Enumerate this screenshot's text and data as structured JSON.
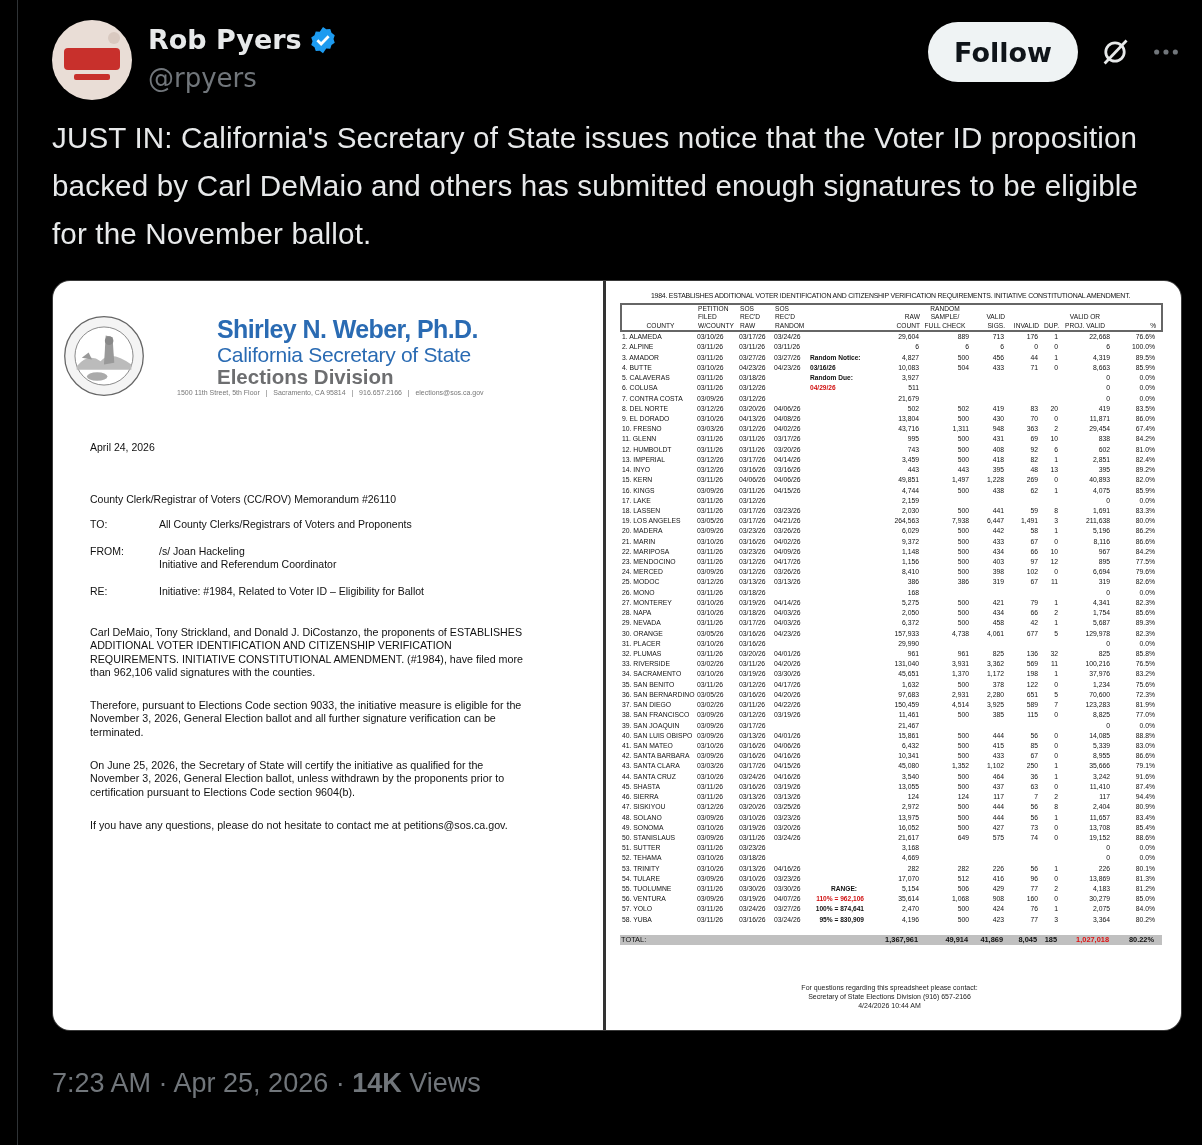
{
  "author": {
    "name": "Rob Pyers",
    "handle": "@rpyers",
    "verified": true
  },
  "follow_button": "Follow",
  "tweet_text": "JUST IN: California's Secretary of State issues notice that the Voter ID proposition backed by Carl DeMaio and others has submitted enough signatures to be eligible for the November ballot.",
  "memo": {
    "name": "Shirley N. Weber, Ph.D.",
    "office": "California Secretary of State",
    "division": "Elections Division",
    "address": "1500 11th Street, 5th Floor   |   Sacramento, CA 95814   |   916.657.2166   |   elections@sos.ca.gov",
    "date": "April 24, 2026",
    "subject": "County Clerk/Registrar of Voters (CC/ROV) Memorandum #26110",
    "fields": [
      {
        "label": "TO:",
        "lines": [
          "All County Clerks/Registrars of Voters and Proponents"
        ]
      },
      {
        "label": "FROM:",
        "lines": [
          "/s/ Joan Hackeling",
          "Initiative and Referendum Coordinator"
        ]
      },
      {
        "label": "RE:",
        "lines": [
          "Initiative: #1984, Related to Voter ID – Eligibility for Ballot"
        ]
      }
    ],
    "paragraphs": [
      "Carl DeMaio, Tony Strickland, and Donald J. DiCostanzo, the proponents of ESTABLISHES ADDITIONAL VOTER IDENTIFICATION AND CITIZENSHIP VERIFICATION REQUIREMENTS. INITIATIVE CONSTITUTIONAL AMENDMENT. (#1984), have filed more than 962,106 valid signatures with the counties.",
      "Therefore, pursuant to Elections Code section 9033, the initiative measure is eligible for the November 3, 2026, General Election ballot and all further signature verification can be terminated.",
      "On June 25, 2026, the Secretary of State will certify the initiative as qualified for the November 3, 2026, General Election ballot, unless withdrawn by the proponents prior to certification pursuant to Elections Code section 9604(b).",
      "If you have any questions, please do not hesitate to contact me at petitions@sos.ca.gov."
    ]
  },
  "sheet": {
    "title": "1984. ESTABLISHES ADDITIONAL VOTER IDENTIFICATION AND CITIZENSHIP VERIFICATION REQUIREMENTS. INITIATIVE CONSTITUTIONAL AMENDMENT.",
    "columns": [
      "COUNTY",
      "PETITION\nFILED\nW/COUNTY",
      "SOS\nREC'D\nRAW",
      "SOS\nREC'D\nRANDOM",
      "RAW\nCOUNT",
      "RANDOM\nSAMPLE/\nFULL CHECK",
      "VALID\nSIGS.",
      "INVALID",
      "DUP.",
      "VALID OR\nPROJ. VALID",
      "%"
    ],
    "rows": [
      {
        "cells": [
          "1. ALAMEDA",
          "03/10/26",
          "03/17/26",
          "03/24/26",
          "29,604",
          "889",
          "713",
          "176",
          "1",
          "22,668",
          "76.6%"
        ]
      },
      {
        "cells": [
          "2. ALPINE",
          "03/11/26",
          "03/11/26",
          "03/11/26",
          "6",
          "6",
          "6",
          "0",
          "0",
          "6",
          "100.0%"
        ]
      },
      {
        "cells": [
          "3. AMADOR",
          "03/11/26",
          "03/27/26",
          "03/27/26",
          "4,827",
          "500",
          "456",
          "44",
          "1",
          "4,319",
          "89.5%"
        ],
        "note": {
          "text": "Random Notice:",
          "kind": "notice"
        }
      },
      {
        "cells": [
          "4. BUTTE",
          "03/10/26",
          "04/23/26",
          "04/23/26",
          "10,083",
          "504",
          "433",
          "71",
          "0",
          "8,663",
          "85.9%"
        ],
        "note": {
          "text": "03/16/26",
          "kind": "notice"
        }
      },
      {
        "cells": [
          "5. CALAVERAS",
          "03/11/26",
          "03/18/26",
          null,
          "3,927",
          null,
          null,
          null,
          null,
          "0",
          "0.0%"
        ],
        "note": {
          "text": "Random Due:",
          "kind": "notice"
        }
      },
      {
        "cells": [
          "6. COLUSA",
          "03/11/26",
          "03/12/26",
          null,
          "511",
          null,
          null,
          null,
          null,
          "0",
          "0.0%"
        ],
        "note": {
          "text": "04/29/26",
          "kind": "alert"
        }
      },
      {
        "cells": [
          "7. CONTRA COSTA",
          "03/09/26",
          "03/12/26",
          null,
          "21,679",
          null,
          null,
          null,
          null,
          "0",
          "0.0%"
        ]
      },
      {
        "cells": [
          "8. DEL NORTE",
          "03/12/26",
          "03/20/26",
          "04/06/26",
          "502",
          "502",
          "419",
          "83",
          "20",
          "419",
          "83.5%"
        ]
      },
      {
        "cells": [
          "9. EL DORADO",
          "03/10/26",
          "04/13/26",
          "04/08/26",
          "13,804",
          "500",
          "430",
          "70",
          "0",
          "11,871",
          "86.0%"
        ]
      },
      {
        "cells": [
          "10. FRESNO",
          "03/03/26",
          "03/12/26",
          "04/02/26",
          "43,716",
          "1,311",
          "948",
          "363",
          "2",
          "29,454",
          "67.4%"
        ]
      },
      {
        "cells": [
          "11. GLENN",
          "03/11/26",
          "03/11/26",
          "03/17/26",
          "995",
          "500",
          "431",
          "69",
          "10",
          "838",
          "84.2%"
        ]
      },
      {
        "cells": [
          "12. HUMBOLDT",
          "03/11/26",
          "03/11/26",
          "03/20/26",
          "743",
          "500",
          "408",
          "92",
          "6",
          "602",
          "81.0%"
        ]
      },
      {
        "cells": [
          "13. IMPERIAL",
          "03/12/26",
          "03/17/26",
          "04/14/26",
          "3,459",
          "500",
          "418",
          "82",
          "1",
          "2,851",
          "82.4%"
        ]
      },
      {
        "cells": [
          "14. INYO",
          "03/12/26",
          "03/16/26",
          "03/16/26",
          "443",
          "443",
          "395",
          "48",
          "13",
          "395",
          "89.2%"
        ]
      },
      {
        "cells": [
          "15. KERN",
          "03/11/26",
          "04/06/26",
          "04/06/26",
          "49,851",
          "1,497",
          "1,228",
          "269",
          "0",
          "40,893",
          "82.0%"
        ]
      },
      {
        "cells": [
          "16. KINGS",
          "03/09/26",
          "03/11/26",
          "04/15/26",
          "4,744",
          "500",
          "438",
          "62",
          "1",
          "4,075",
          "85.9%"
        ]
      },
      {
        "cells": [
          "17. LAKE",
          "03/11/26",
          "03/12/26",
          null,
          "2,159",
          null,
          null,
          null,
          null,
          "0",
          "0.0%"
        ]
      },
      {
        "cells": [
          "18. LASSEN",
          "03/11/26",
          "03/17/26",
          "03/23/26",
          "2,030",
          "500",
          "441",
          "59",
          "8",
          "1,691",
          "83.3%"
        ]
      },
      {
        "cells": [
          "19. LOS ANGELES",
          "03/05/26",
          "03/17/26",
          "04/21/26",
          "264,563",
          "7,938",
          "6,447",
          "1,491",
          "3",
          "211,638",
          "80.0%"
        ]
      },
      {
        "cells": [
          "20. MADERA",
          "03/09/26",
          "03/23/26",
          "03/26/26",
          "6,029",
          "500",
          "442",
          "58",
          "1",
          "5,196",
          "86.2%"
        ]
      },
      {
        "cells": [
          "21. MARIN",
          "03/10/26",
          "03/16/26",
          "04/02/26",
          "9,372",
          "500",
          "433",
          "67",
          "0",
          "8,116",
          "86.6%"
        ]
      },
      {
        "cells": [
          "22. MARIPOSA",
          "03/11/26",
          "03/23/26",
          "04/09/26",
          "1,148",
          "500",
          "434",
          "66",
          "10",
          "967",
          "84.2%"
        ]
      },
      {
        "cells": [
          "23. MENDOCINO",
          "03/11/26",
          "03/12/26",
          "04/17/26",
          "1,156",
          "500",
          "403",
          "97",
          "12",
          "895",
          "77.5%"
        ]
      },
      {
        "cells": [
          "24. MERCED",
          "03/09/26",
          "03/12/26",
          "03/26/26",
          "8,410",
          "500",
          "398",
          "102",
          "0",
          "6,694",
          "79.6%"
        ]
      },
      {
        "cells": [
          "25. MODOC",
          "03/12/26",
          "03/13/26",
          "03/13/26",
          "386",
          "386",
          "319",
          "67",
          "11",
          "319",
          "82.6%"
        ]
      },
      {
        "cells": [
          "26. MONO",
          "03/11/26",
          "03/18/26",
          null,
          "168",
          null,
          null,
          null,
          null,
          "0",
          "0.0%"
        ]
      },
      {
        "cells": [
          "27. MONTEREY",
          "03/10/26",
          "03/19/26",
          "04/14/26",
          "5,275",
          "500",
          "421",
          "79",
          "1",
          "4,341",
          "82.3%"
        ]
      },
      {
        "cells": [
          "28. NAPA",
          "03/10/26",
          "03/18/26",
          "04/03/26",
          "2,050",
          "500",
          "434",
          "66",
          "2",
          "1,754",
          "85.6%"
        ]
      },
      {
        "cells": [
          "29. NEVADA",
          "03/11/26",
          "03/17/26",
          "04/03/26",
          "6,372",
          "500",
          "458",
          "42",
          "1",
          "5,687",
          "89.3%"
        ]
      },
      {
        "cells": [
          "30. ORANGE",
          "03/05/26",
          "03/16/26",
          "04/23/26",
          "157,933",
          "4,738",
          "4,061",
          "677",
          "5",
          "129,978",
          "82.3%"
        ]
      },
      {
        "cells": [
          "31. PLACER",
          "03/10/26",
          "03/16/26",
          null,
          "29,990",
          null,
          null,
          null,
          null,
          "0",
          "0.0%"
        ]
      },
      {
        "cells": [
          "32. PLUMAS",
          "03/11/26",
          "03/20/26",
          "04/01/26",
          "961",
          "961",
          "825",
          "136",
          "32",
          "825",
          "85.8%"
        ]
      },
      {
        "cells": [
          "33. RIVERSIDE",
          "03/02/26",
          "03/11/26",
          "04/20/26",
          "131,040",
          "3,931",
          "3,362",
          "569",
          "11",
          "100,216",
          "76.5%"
        ]
      },
      {
        "cells": [
          "34. SACRAMENTO",
          "03/10/26",
          "03/19/26",
          "03/30/26",
          "45,651",
          "1,370",
          "1,172",
          "198",
          "1",
          "37,976",
          "83.2%"
        ]
      },
      {
        "cells": [
          "35. SAN BENITO",
          "03/11/26",
          "03/12/26",
          "04/17/26",
          "1,632",
          "500",
          "378",
          "122",
          "0",
          "1,234",
          "75.6%"
        ]
      },
      {
        "cells": [
          "36. SAN BERNARDINO",
          "03/05/26",
          "03/16/26",
          "04/20/26",
          "97,683",
          "2,931",
          "2,280",
          "651",
          "5",
          "70,600",
          "72.3%"
        ]
      },
      {
        "cells": [
          "37. SAN DIEGO",
          "03/02/26",
          "03/11/26",
          "04/22/26",
          "150,459",
          "4,514",
          "3,925",
          "589",
          "7",
          "123,283",
          "81.9%"
        ]
      },
      {
        "cells": [
          "38. SAN FRANCISCO",
          "03/09/26",
          "03/12/26",
          "03/19/26",
          "11,461",
          "500",
          "385",
          "115",
          "0",
          "8,825",
          "77.0%"
        ]
      },
      {
        "cells": [
          "39. SAN JOAQUIN",
          "03/09/26",
          "03/17/26",
          null,
          "21,467",
          null,
          null,
          null,
          null,
          "0",
          "0.0%"
        ]
      },
      {
        "cells": [
          "40. SAN LUIS OBISPO",
          "03/09/26",
          "03/13/26",
          "04/01/26",
          "15,861",
          "500",
          "444",
          "56",
          "0",
          "14,085",
          "88.8%"
        ]
      },
      {
        "cells": [
          "41. SAN MATEO",
          "03/10/26",
          "03/16/26",
          "04/06/26",
          "6,432",
          "500",
          "415",
          "85",
          "0",
          "5,339",
          "83.0%"
        ]
      },
      {
        "cells": [
          "42. SANTA BARBARA",
          "03/09/26",
          "03/16/26",
          "04/16/26",
          "10,341",
          "500",
          "433",
          "67",
          "0",
          "8,955",
          "86.6%"
        ]
      },
      {
        "cells": [
          "43. SANTA CLARA",
          "03/03/26",
          "03/17/26",
          "04/15/26",
          "45,080",
          "1,352",
          "1,102",
          "250",
          "1",
          "35,666",
          "79.1%"
        ]
      },
      {
        "cells": [
          "44. SANTA CRUZ",
          "03/10/26",
          "03/24/26",
          "04/16/26",
          "3,540",
          "500",
          "464",
          "36",
          "1",
          "3,242",
          "91.6%"
        ]
      },
      {
        "cells": [
          "45. SHASTA",
          "03/11/26",
          "03/16/26",
          "03/19/26",
          "13,055",
          "500",
          "437",
          "63",
          "0",
          "11,410",
          "87.4%"
        ]
      },
      {
        "cells": [
          "46. SIERRA",
          "03/11/26",
          "03/13/26",
          "03/13/26",
          "124",
          "124",
          "117",
          "7",
          "2",
          "117",
          "94.4%"
        ]
      },
      {
        "cells": [
          "47. SISKIYOU",
          "03/12/26",
          "03/20/26",
          "03/25/26",
          "2,972",
          "500",
          "444",
          "56",
          "8",
          "2,404",
          "80.9%"
        ]
      },
      {
        "cells": [
          "48. SOLANO",
          "03/09/26",
          "03/10/26",
          "03/23/26",
          "13,975",
          "500",
          "444",
          "56",
          "1",
          "11,657",
          "83.4%"
        ]
      },
      {
        "cells": [
          "49. SONOMA",
          "03/10/26",
          "03/19/26",
          "03/20/26",
          "16,052",
          "500",
          "427",
          "73",
          "0",
          "13,708",
          "85.4%"
        ]
      },
      {
        "cells": [
          "50. STANISLAUS",
          "03/09/26",
          "03/11/26",
          "03/24/26",
          "21,617",
          "649",
          "575",
          "74",
          "0",
          "19,152",
          "88.6%"
        ]
      },
      {
        "cells": [
          "51. SUTTER",
          "03/11/26",
          "03/23/26",
          null,
          "3,168",
          null,
          null,
          null,
          null,
          "0",
          "0.0%"
        ]
      },
      {
        "cells": [
          "52. TEHAMA",
          "03/10/26",
          "03/18/26",
          null,
          "4,669",
          null,
          null,
          null,
          null,
          "0",
          "0.0%"
        ]
      },
      {
        "cells": [
          "53. TRINITY",
          "03/10/26",
          "03/13/26",
          "04/16/26",
          "282",
          "282",
          "226",
          "56",
          "1",
          "226",
          "80.1%"
        ]
      },
      {
        "cells": [
          "54. TULARE",
          "03/09/26",
          "03/10/26",
          "03/23/26",
          "17,070",
          "512",
          "416",
          "96",
          "0",
          "13,869",
          "81.3%"
        ]
      },
      {
        "cells": [
          "55. TUOLUMNE",
          "03/11/26",
          "03/30/26",
          "03/30/26",
          "5,154",
          "506",
          "429",
          "77",
          "2",
          "4,183",
          "81.2%"
        ],
        "note": {
          "text": "RANGE:",
          "kind": "range_title"
        }
      },
      {
        "cells": [
          "56. VENTURA",
          "03/09/26",
          "03/19/26",
          "04/07/26",
          "35,614",
          "1,068",
          "908",
          "160",
          "0",
          "30,279",
          "85.0%"
        ],
        "note": {
          "text": "110% = 962,106",
          "kind": "range_alert"
        }
      },
      {
        "cells": [
          "57. YOLO",
          "03/11/26",
          "03/24/26",
          "03/27/26",
          "2,470",
          "500",
          "424",
          "76",
          "1",
          "2,075",
          "84.0%"
        ],
        "note": {
          "text": "100% = 874,641",
          "kind": "range"
        }
      },
      {
        "cells": [
          "58. YUBA",
          "03/11/26",
          "03/16/26",
          "03/24/26",
          "4,196",
          "500",
          "423",
          "77",
          "3",
          "3,364",
          "80.2%"
        ],
        "note": {
          "text": "95% = 830,909",
          "kind": "range"
        }
      }
    ],
    "total": {
      "label": "TOTAL:",
      "cells": [
        "1,367,961",
        "49,914",
        "41,869",
        "8,045",
        "185",
        "1,027,018",
        "80.22%"
      ]
    },
    "footer": [
      "For questions regarding this spreadsheet please contact:",
      "Secretary of State Elections Division  (916) 657-2166",
      "4/24/2026 10:44 AM"
    ]
  },
  "meta": "7:23 AM · Apr 25, 2026 · **14K** Views"
}
